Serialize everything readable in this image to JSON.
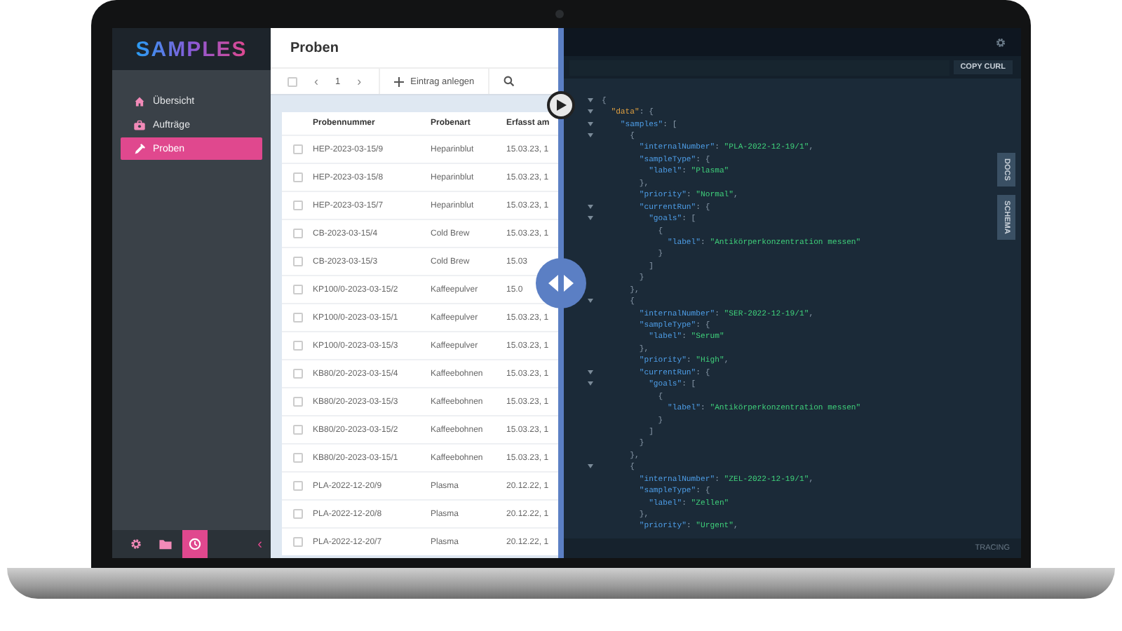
{
  "sidebar": {
    "logo": "SAMPLES",
    "items": [
      {
        "label": "Übersicht",
        "selected": false
      },
      {
        "label": "Aufträge",
        "selected": false
      },
      {
        "label": "Proben",
        "selected": true
      }
    ],
    "footer": [
      {
        "selected": false
      },
      {
        "selected": false
      },
      {
        "selected": true
      }
    ],
    "collapse": "‹"
  },
  "list": {
    "title": "Proben",
    "toolbar": {
      "checked": false,
      "prev": "‹",
      "page": "1",
      "next": "›",
      "add": "Eintrag anlegen"
    },
    "table": {
      "columns": [
        "Probennummer",
        "Probenart",
        "Erfasst am"
      ],
      "rows": [
        {
          "checked": false,
          "cells": [
            "HEP-2023-03-15/9",
            "Heparinblut",
            "15.03.23, 1"
          ]
        },
        {
          "checked": false,
          "cells": [
            "HEP-2023-03-15/8",
            "Heparinblut",
            "15.03.23, 1"
          ]
        },
        {
          "checked": false,
          "cells": [
            "HEP-2023-03-15/7",
            "Heparinblut",
            "15.03.23, 1"
          ]
        },
        {
          "checked": false,
          "cells": [
            "CB-2023-03-15/4",
            "Cold Brew",
            "15.03.23, 1"
          ]
        },
        {
          "checked": false,
          "cells": [
            "CB-2023-03-15/3",
            "Cold Brew",
            "15.03"
          ]
        },
        {
          "checked": false,
          "cells": [
            "KP100/0-2023-03-15/2",
            "Kaffeepulver",
            "15.0"
          ]
        },
        {
          "checked": false,
          "cells": [
            "KP100/0-2023-03-15/1",
            "Kaffeepulver",
            "15.03.23, 1"
          ]
        },
        {
          "checked": false,
          "cells": [
            "KP100/0-2023-03-15/3",
            "Kaffeepulver",
            "15.03.23, 1"
          ]
        },
        {
          "checked": false,
          "cells": [
            "KB80/20-2023-03-15/4",
            "Kaffeebohnen",
            "15.03.23, 1"
          ]
        },
        {
          "checked": false,
          "cells": [
            "KB80/20-2023-03-15/3",
            "Kaffeebohnen",
            "15.03.23, 1"
          ]
        },
        {
          "checked": false,
          "cells": [
            "KB80/20-2023-03-15/2",
            "Kaffeebohnen",
            "15.03.23, 1"
          ]
        },
        {
          "checked": false,
          "cells": [
            "KB80/20-2023-03-15/1",
            "Kaffeebohnen",
            "15.03.23, 1"
          ]
        },
        {
          "checked": false,
          "cells": [
            "PLA-2022-12-20/9",
            "Plasma",
            "20.12.22, 1"
          ]
        },
        {
          "checked": false,
          "cells": [
            "PLA-2022-12-20/8",
            "Plasma",
            "20.12.22, 1"
          ]
        },
        {
          "checked": false,
          "cells": [
            "PLA-2022-12-20/7",
            "Plasma",
            "20.12.22, 1"
          ]
        }
      ]
    }
  },
  "explorer": {
    "copy_button": "COPY CURL",
    "side_tabs": [
      "DOCS",
      "SCHEMA"
    ],
    "footer": "TRACING",
    "lines": [
      {
        "fold": true,
        "parts": [
          {
            "kind": "punct",
            "text": "{"
          }
        ]
      },
      {
        "fold": true,
        "parts": [
          {
            "kind": "root",
            "text": "  \"data\""
          },
          {
            "kind": "punct",
            "text": ": {"
          }
        ]
      },
      {
        "fold": true,
        "parts": [
          {
            "kind": "key",
            "text": "    \"samples\""
          },
          {
            "kind": "punct",
            "text": ": ["
          }
        ]
      },
      {
        "fold": true,
        "parts": [
          {
            "kind": "punct",
            "text": "      {"
          }
        ]
      },
      {
        "fold": false,
        "parts": [
          {
            "kind": "key",
            "text": "        \"internalNumber\""
          },
          {
            "kind": "punct",
            "text": ": "
          },
          {
            "kind": "string",
            "text": "\"PLA-2022-12-19/1\""
          },
          {
            "kind": "punct",
            "text": ","
          }
        ]
      },
      {
        "fold": false,
        "parts": [
          {
            "kind": "key",
            "text": "        \"sampleType\""
          },
          {
            "kind": "punct",
            "text": ": {"
          }
        ]
      },
      {
        "fold": false,
        "parts": [
          {
            "kind": "key",
            "text": "          \"label\""
          },
          {
            "kind": "punct",
            "text": ": "
          },
          {
            "kind": "string",
            "text": "\"Plasma\""
          }
        ]
      },
      {
        "fold": false,
        "parts": [
          {
            "kind": "punct",
            "text": "        },"
          }
        ]
      },
      {
        "fold": false,
        "parts": [
          {
            "kind": "key",
            "text": "        \"priority\""
          },
          {
            "kind": "punct",
            "text": ": "
          },
          {
            "kind": "string",
            "text": "\"Normal\""
          },
          {
            "kind": "punct",
            "text": ","
          }
        ]
      },
      {
        "fold": true,
        "parts": [
          {
            "kind": "key",
            "text": "        \"currentRun\""
          },
          {
            "kind": "punct",
            "text": ": {"
          }
        ]
      },
      {
        "fold": true,
        "parts": [
          {
            "kind": "key",
            "text": "          \"goals\""
          },
          {
            "kind": "punct",
            "text": ": ["
          }
        ]
      },
      {
        "fold": false,
        "parts": [
          {
            "kind": "punct",
            "text": "            {"
          }
        ]
      },
      {
        "fold": false,
        "parts": [
          {
            "kind": "key",
            "text": "              \"label\""
          },
          {
            "kind": "punct",
            "text": ": "
          },
          {
            "kind": "string",
            "text": "\"Antikörperkonzentration messen\""
          }
        ]
      },
      {
        "fold": false,
        "parts": [
          {
            "kind": "punct",
            "text": "            }"
          }
        ]
      },
      {
        "fold": false,
        "parts": [
          {
            "kind": "punct",
            "text": "          ]"
          }
        ]
      },
      {
        "fold": false,
        "parts": [
          {
            "kind": "punct",
            "text": "        }"
          }
        ]
      },
      {
        "fold": false,
        "parts": [
          {
            "kind": "punct",
            "text": "      },"
          }
        ]
      },
      {
        "fold": true,
        "parts": [
          {
            "kind": "punct",
            "text": "      {"
          }
        ]
      },
      {
        "fold": false,
        "parts": [
          {
            "kind": "key",
            "text": "        \"internalNumber\""
          },
          {
            "kind": "punct",
            "text": ": "
          },
          {
            "kind": "string",
            "text": "\"SER-2022-12-19/1\""
          },
          {
            "kind": "punct",
            "text": ","
          }
        ]
      },
      {
        "fold": false,
        "parts": [
          {
            "kind": "key",
            "text": "        \"sampleType\""
          },
          {
            "kind": "punct",
            "text": ": {"
          }
        ]
      },
      {
        "fold": false,
        "parts": [
          {
            "kind": "key",
            "text": "          \"label\""
          },
          {
            "kind": "punct",
            "text": ": "
          },
          {
            "kind": "string",
            "text": "\"Serum\""
          }
        ]
      },
      {
        "fold": false,
        "parts": [
          {
            "kind": "punct",
            "text": "        },"
          }
        ]
      },
      {
        "fold": false,
        "parts": [
          {
            "kind": "key",
            "text": "        \"priority\""
          },
          {
            "kind": "punct",
            "text": ": "
          },
          {
            "kind": "string",
            "text": "\"High\""
          },
          {
            "kind": "punct",
            "text": ","
          }
        ]
      },
      {
        "fold": true,
        "parts": [
          {
            "kind": "key",
            "text": "        \"currentRun\""
          },
          {
            "kind": "punct",
            "text": ": {"
          }
        ]
      },
      {
        "fold": true,
        "parts": [
          {
            "kind": "key",
            "text": "          \"goals\""
          },
          {
            "kind": "punct",
            "text": ": ["
          }
        ]
      },
      {
        "fold": false,
        "parts": [
          {
            "kind": "punct",
            "text": "            {"
          }
        ]
      },
      {
        "fold": false,
        "parts": [
          {
            "kind": "key",
            "text": "              \"label\""
          },
          {
            "kind": "punct",
            "text": ": "
          },
          {
            "kind": "string",
            "text": "\"Antikörperkonzentration messen\""
          }
        ]
      },
      {
        "fold": false,
        "parts": [
          {
            "kind": "punct",
            "text": "            }"
          }
        ]
      },
      {
        "fold": false,
        "parts": [
          {
            "kind": "punct",
            "text": "          ]"
          }
        ]
      },
      {
        "fold": false,
        "parts": [
          {
            "kind": "punct",
            "text": "        }"
          }
        ]
      },
      {
        "fold": false,
        "parts": [
          {
            "kind": "punct",
            "text": "      },"
          }
        ]
      },
      {
        "fold": true,
        "parts": [
          {
            "kind": "punct",
            "text": "      {"
          }
        ]
      },
      {
        "fold": false,
        "parts": [
          {
            "kind": "key",
            "text": "        \"internalNumber\""
          },
          {
            "kind": "punct",
            "text": ": "
          },
          {
            "kind": "string",
            "text": "\"ZEL-2022-12-19/1\""
          },
          {
            "kind": "punct",
            "text": ","
          }
        ]
      },
      {
        "fold": false,
        "parts": [
          {
            "kind": "key",
            "text": "        \"sampleType\""
          },
          {
            "kind": "punct",
            "text": ": {"
          }
        ]
      },
      {
        "fold": false,
        "parts": [
          {
            "kind": "key",
            "text": "          \"label\""
          },
          {
            "kind": "punct",
            "text": ": "
          },
          {
            "kind": "string",
            "text": "\"Zellen\""
          }
        ]
      },
      {
        "fold": false,
        "parts": [
          {
            "kind": "punct",
            "text": "        },"
          }
        ]
      },
      {
        "fold": false,
        "parts": [
          {
            "kind": "key",
            "text": "        \"priority\""
          },
          {
            "kind": "punct",
            "text": ": "
          },
          {
            "kind": "string",
            "text": "\"Urgent\""
          },
          {
            "kind": "punct",
            "text": ","
          }
        ]
      }
    ]
  }
}
